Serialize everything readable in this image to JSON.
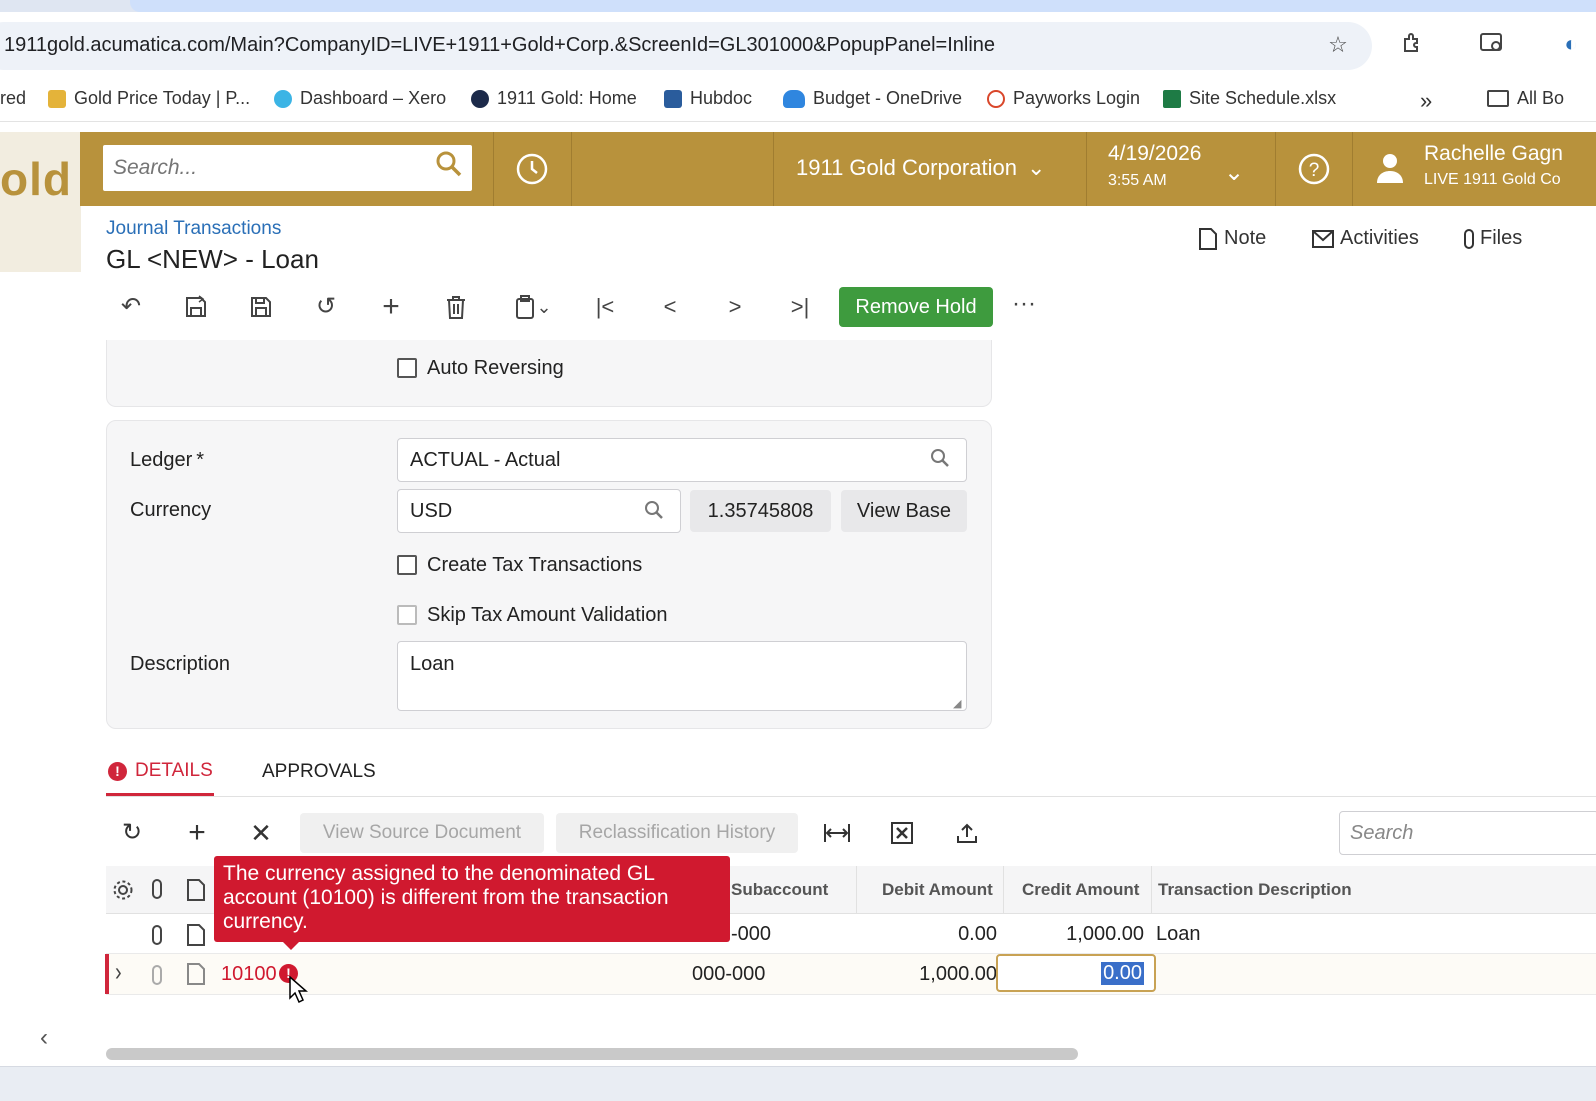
{
  "browser": {
    "url": "1911gold.acumatica.com/Main?CompanyID=LIVE+1911+Gold+Corp.&ScreenId=GL301000&PopupPanel=Inline",
    "bookmarks": [
      {
        "label": "red"
      },
      {
        "label": "Gold Price Today | P..."
      },
      {
        "label": "Dashboard – Xero"
      },
      {
        "label": "1911 Gold: Home"
      },
      {
        "label": "Hubdoc"
      },
      {
        "label": "Budget - OneDrive"
      },
      {
        "label": "Payworks Login"
      },
      {
        "label": "Site Schedule.xlsx"
      }
    ],
    "bookmarks_overflow": "»",
    "all_bookmarks": "All Bo"
  },
  "header": {
    "logo": "old",
    "search_placeholder": "Search...",
    "company": "1911 Gold Corporation",
    "date": "4/19/2026",
    "time": "3:55 AM",
    "user_name": "Rachelle Gagn",
    "user_tenant": "LIVE 1911 Gold Co"
  },
  "page": {
    "breadcrumb": "Journal Transactions",
    "title": "GL <NEW> - Loan",
    "actions": {
      "note": "Note",
      "activities": "Activities",
      "files": "Files"
    },
    "toolbar": {
      "remove_hold": "Remove Hold",
      "more": "···"
    }
  },
  "form": {
    "auto_reversing": "Auto Reversing",
    "ledger_label": "Ledger",
    "ledger_required": "*",
    "ledger_value": "ACTUAL - Actual",
    "currency_label": "Currency",
    "currency_value": "USD",
    "currency_rate": "1.35745808",
    "view_base": "View Base",
    "create_tax": "Create Tax Transactions",
    "skip_tax": "Skip Tax Amount Validation",
    "description_label": "Description",
    "description_value": "Loan"
  },
  "tabs": {
    "details": "DETAILS",
    "approvals": "APPROVALS"
  },
  "grid_toolbar": {
    "view_source": "View Source Document",
    "reclass_history": "Reclassification History",
    "search_placeholder": "Search"
  },
  "grid": {
    "headers": {
      "subaccount": "Subaccount",
      "debit": "Debit Amount",
      "credit": "Credit Amount",
      "description": "Transaction Description"
    },
    "rows": [
      {
        "account": "",
        "subaccount": "-000",
        "debit": "0.00",
        "credit": "1,000.00",
        "description": "Loan"
      },
      {
        "account": "10100",
        "subaccount": "000-000",
        "debit": "1,000.00",
        "credit": "0.00",
        "description": ""
      }
    ]
  },
  "tooltip": {
    "message": "The currency assigned to the denominated GL account (10100) is different from the transaction currency."
  },
  "colors": {
    "header_gold": "#b8923c",
    "error_red": "#d0192f",
    "primary_green": "#3e9b3e",
    "link_blue": "#2a6fb7"
  }
}
